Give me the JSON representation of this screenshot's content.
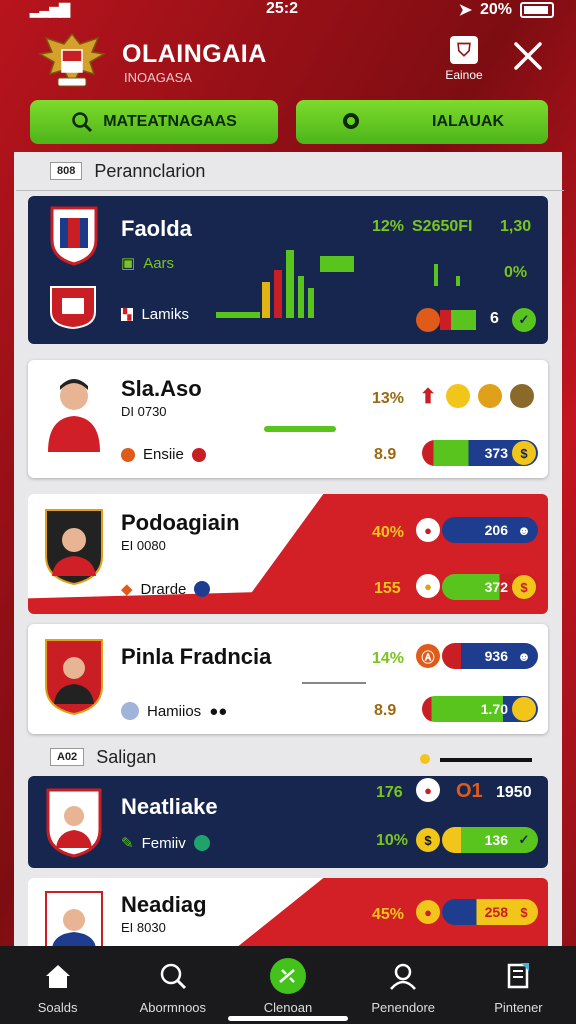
{
  "status": {
    "time": "25:2",
    "battery": "20%"
  },
  "header": {
    "title": "OLAINGAIA",
    "subtitle": "INOAGASA",
    "action_label": "Eainoe",
    "search_button": "MATEATNAGAAS",
    "second_button": "IALAUAK"
  },
  "sections": [
    {
      "tag": "808",
      "label": "Perannclarion"
    },
    {
      "tag": "A02",
      "label": "Saligan"
    }
  ],
  "cards": [
    {
      "name": "Faolda",
      "sub": "Aars",
      "mini": "Lamiks",
      "stats": [
        "12%",
        "S2650FI",
        "1,30",
        "0%"
      ],
      "badge": "6"
    },
    {
      "name": "Sla.Aso",
      "sub": "DI 0730",
      "mini": "Ensiie",
      "stats": [
        "13%",
        "8.9",
        "373"
      ]
    },
    {
      "name": "Podoagiain",
      "sub": "EI 0080",
      "mini": "Drarde",
      "stats": [
        "40%",
        "155",
        "206",
        "372"
      ]
    },
    {
      "name": "Pinla Fradncia",
      "sub": "",
      "mini": "Hamiios",
      "stats": [
        "14%",
        "8.9",
        "936",
        "1.70"
      ]
    },
    {
      "name": "Neatliake",
      "sub": "",
      "mini": "Femiiv",
      "stats": [
        "176",
        "10%",
        "136",
        "O1",
        "1950"
      ]
    },
    {
      "name": "Neadiag",
      "sub": "EI 8030",
      "mini": "",
      "stats": [
        "45%",
        "258"
      ]
    }
  ],
  "nav": [
    {
      "label": "Soalds",
      "icon": "home-icon"
    },
    {
      "label": "Abormnoos",
      "icon": "search-icon"
    },
    {
      "label": "Clenoan",
      "icon": "whistle-icon"
    },
    {
      "label": "Penendore",
      "icon": "team-icon"
    },
    {
      "label": "Pintener",
      "icon": "trophy-icon"
    }
  ],
  "colors": {
    "accent_green": "#5ac41f",
    "brand_red": "#b8141d",
    "navy": "#16264e"
  }
}
